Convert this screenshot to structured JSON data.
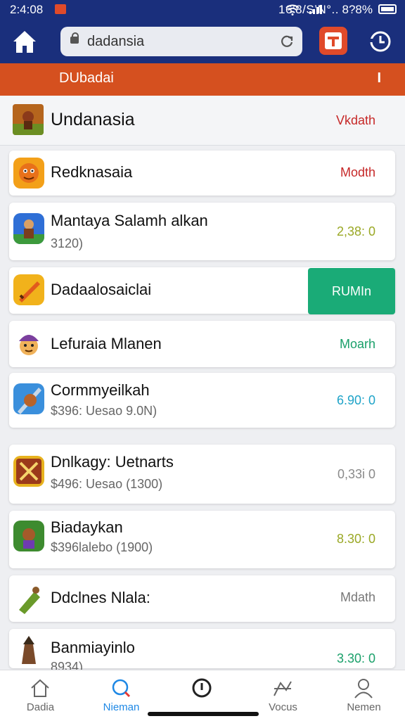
{
  "status_bar": {
    "time": "2:4:08",
    "info": "16’8/S’N°..",
    "battery": "8?8%"
  },
  "browser": {
    "url": "dadansia"
  },
  "subheader": {
    "title": "DUbadai",
    "menu": "I"
  },
  "section": {
    "name": "Undanasia",
    "action": "Vkdath"
  },
  "apps": [
    {
      "name": "Redknasaia",
      "sub": "",
      "action": "Modth",
      "action_color": "#c62828"
    },
    {
      "name": "Mantaya Salamh alkan",
      "sub": "3120)",
      "action": "2,38: 0",
      "action_color": "#9aa825"
    },
    {
      "name": "Dadaalosaiclai",
      "sub": "",
      "action": "RUMIn",
      "action_color": "#ffffff"
    },
    {
      "name": "Lefuraia Mlanen",
      "sub": "",
      "action": "Moarh",
      "action_color": "#1aa06a"
    },
    {
      "name": "Cormmyeilkah",
      "sub": "$396: Uesao 9.0N)",
      "action": "6.90: 0",
      "action_color": "#1ea3c8"
    },
    {
      "name": "Dnlkagy: Uetnarts",
      "sub": "$496: Uesao (1300)",
      "action": "0,33i 0",
      "action_color": "#8a8a8a"
    },
    {
      "name": "Biadaykan",
      "sub": "$396lalebo (1900)",
      "action": "8.30: 0",
      "action_color": "#9aa825"
    },
    {
      "name": "Ddclnes Nlala:",
      "sub": "",
      "action": "Mdath",
      "action_color": "#777777"
    },
    {
      "name": "Banmiayinlo",
      "sub": "8934)",
      "action": "3.30: 0",
      "action_color": "#1aa06a"
    }
  ],
  "bottom_nav": [
    {
      "label": "Dadia",
      "icon": "home-icon"
    },
    {
      "label": "Nieman",
      "icon": "search-icon"
    },
    {
      "label": "",
      "icon": "record-icon"
    },
    {
      "label": "Vocus",
      "icon": "shapes-icon"
    },
    {
      "label": "Nemen",
      "icon": "profile-icon"
    }
  ],
  "colors": {
    "header_blue": "#1a2f7c",
    "accent_orange": "#d5501f",
    "active_blue": "#1e88e5",
    "run_green": "#1aab77"
  }
}
